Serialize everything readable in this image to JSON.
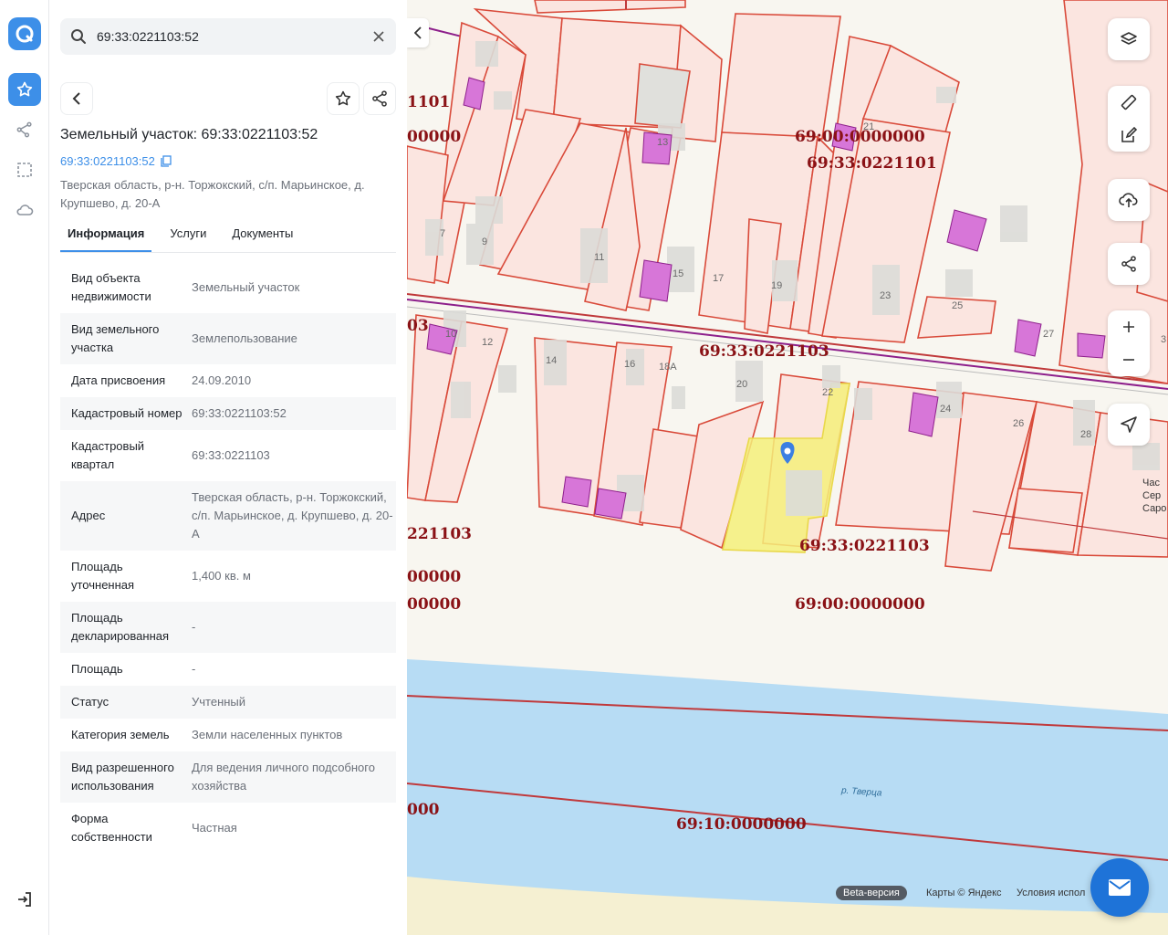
{
  "search": {
    "value": "69:33:0221103:52"
  },
  "parcel": {
    "title": "Земельный участок: 69:33:0221103:52",
    "cad_number": "69:33:0221103:52",
    "address": "Тверская область, р-н. Торжокский, с/п. Марьинское, д. Крупшево, д. 20-А"
  },
  "tabs": [
    {
      "label": "Информация",
      "active": true
    },
    {
      "label": "Услуги",
      "active": false
    },
    {
      "label": "Документы",
      "active": false
    }
  ],
  "rows": [
    {
      "k": "Вид объекта недвижимости",
      "v": "Земельный участок"
    },
    {
      "k": "Вид земельного участка",
      "v": "Землепользование"
    },
    {
      "k": "Дата присвоения",
      "v": "24.09.2010"
    },
    {
      "k": "Кадастровый номер",
      "v": "69:33:0221103:52"
    },
    {
      "k": "Кадастровый квартал",
      "v": "69:33:0221103"
    },
    {
      "k": "Адрес",
      "v": "Тверская область, р-н. Торжокский, с/п. Марьинское, д. Крупшево, д. 20-А"
    },
    {
      "k": "Площадь уточненная",
      "v": "1,400 кв. м"
    },
    {
      "k": "Площадь декларированная",
      "v": "-"
    },
    {
      "k": "Площадь",
      "v": "-"
    },
    {
      "k": "Статус",
      "v": "Учтенный"
    },
    {
      "k": "Категория земель",
      "v": "Земли населенных пунктов"
    },
    {
      "k": "Вид разрешенного использования",
      "v": "Для ведения личного подсобного хозяйства"
    },
    {
      "k": "Форма собственности",
      "v": "Частная"
    }
  ],
  "map": {
    "quarter_labels": [
      "1101",
      "00000",
      "69:00:0000000",
      "69:33:0221101",
      "03",
      "69:33:0221103",
      "221103",
      "69:33:0221103",
      "00000",
      "00000",
      "69:00:0000000",
      "000",
      "69:10:0000000"
    ],
    "house_numbers": [
      "13",
      "21",
      "7",
      "9",
      "11",
      "15",
      "17",
      "19",
      "23",
      "25",
      "10",
      "12",
      "14",
      "16",
      "18А",
      "20",
      "22",
      "24",
      "26",
      "27",
      "28",
      "3"
    ],
    "river_label": "р. Тверца",
    "beta": "Beta-версия",
    "attribution": "Карты © Яндекс",
    "terms": "Условия испол",
    "edge_text": [
      "Час",
      "Сер",
      "Саро"
    ]
  },
  "colors": {
    "accent": "#3d8fe8",
    "parcel": "#fbe5e0",
    "boundary": "#d94a3a",
    "selected": "#f5f07a",
    "building": "#d776d8",
    "water": "#b7dcf4"
  }
}
